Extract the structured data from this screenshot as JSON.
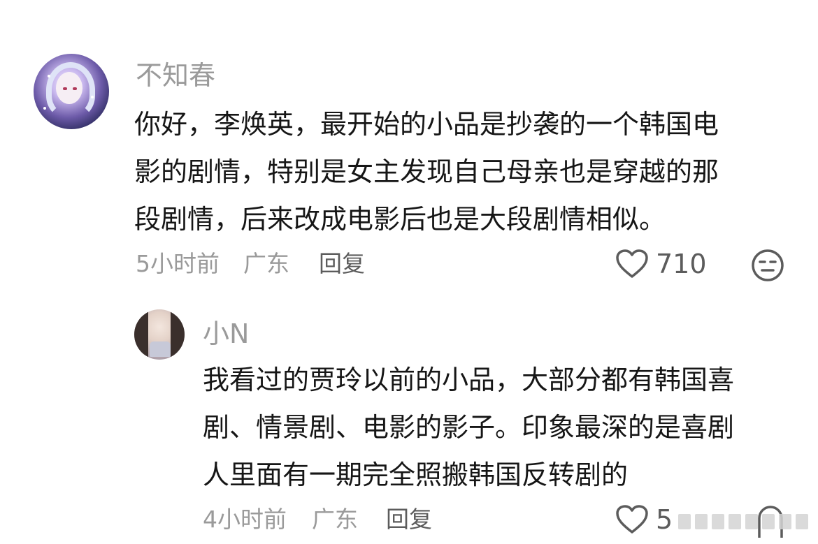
{
  "comment": {
    "username": "不知春",
    "lines": [
      "你好，李焕英，最开始的小品是抄袭的一个韩国电",
      "影的剧情，特别是女主发现自己母亲也是穿越的那",
      "段剧情，后来改成电影后也是大段剧情相似。"
    ],
    "time": "5小时前",
    "location": "广东",
    "reply_label": "回复",
    "likes": "710"
  },
  "reply": {
    "username": "小N",
    "lines": [
      "我看过的贾玲以前的小品，大部分都有韩国喜",
      "剧、情景剧、电影的影子。印象最深的是喜剧",
      "人里面有一期完全照搬韩国反转剧的"
    ],
    "time": "4小时前",
    "location": "广东",
    "reply_label": "回复",
    "likes": "5"
  },
  "icons": {
    "like": "heart-outline-icon",
    "dislike": "meh-face-icon"
  },
  "colors": {
    "text": "#161616",
    "meta": "#9a9a9a",
    "action": "#5c5c5c"
  }
}
